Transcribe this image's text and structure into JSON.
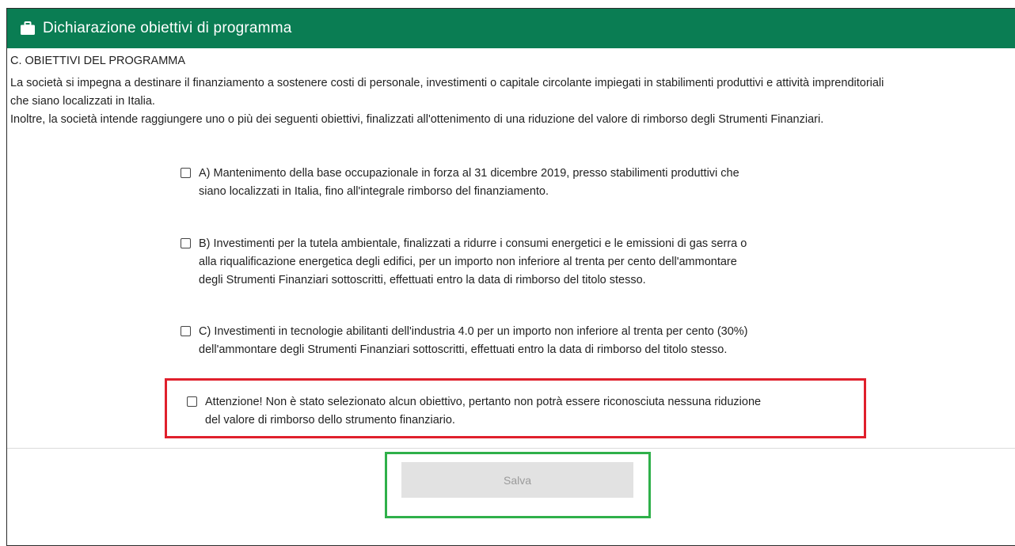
{
  "header": {
    "icon": "briefcase-icon",
    "title": "Dichiarazione obiettivi di programma",
    "background": "#0a7d53"
  },
  "section": {
    "title": "C. OBIETTIVI DEL PROGRAMMA",
    "paragraph_line1": "La società si impegna a destinare il finanziamento a sostenere costi di personale, investimenti o capitale circolante impiegati in stabilimenti produttivi e attività imprenditoriali",
    "paragraph_line2": "che siano localizzati in Italia.",
    "paragraph_line3": "Inoltre, la società intende raggiungere uno o più dei seguenti obiettivi, finalizzati all'ottenimento di una riduzione del valore di rimborso degli Strumenti Finanziari."
  },
  "options": [
    {
      "line1": "A) Mantenimento della base occupazionale in forza al 31 dicembre 2019, presso stabilimenti produttivi che",
      "line2": "siano localizzati in Italia, fino all'integrale rimborso del finanziamento.",
      "checked": false
    },
    {
      "line1": "B) Investimenti per la tutela ambientale, finalizzati a ridurre i consumi energetici e le emissioni di gas serra o",
      "line2": "alla riqualificazione energetica degli edifici, per un importo non inferiore al trenta per cento dell'ammontare",
      "line3": "degli Strumenti Finanziari sottoscritti, effettuati entro la data di rimborso del titolo stesso.",
      "checked": false
    },
    {
      "line1": "C) Investimenti in tecnologie abilitanti dell'industria 4.0 per un importo non inferiore al trenta per cento (30%)",
      "line2": "dell'ammontare degli Strumenti Finanziari sottoscritti, effettuati entro la data di rimborso del titolo stesso.",
      "checked": false
    }
  ],
  "warning": {
    "line1": "Attenzione! Non è stato selezionato alcun obiettivo, pertanto non potrà essere riconosciuta nessuna riduzione",
    "line2": "del valore di rimborso dello strumento finanziario.",
    "checked": false
  },
  "footer": {
    "save_label": "Salva"
  }
}
